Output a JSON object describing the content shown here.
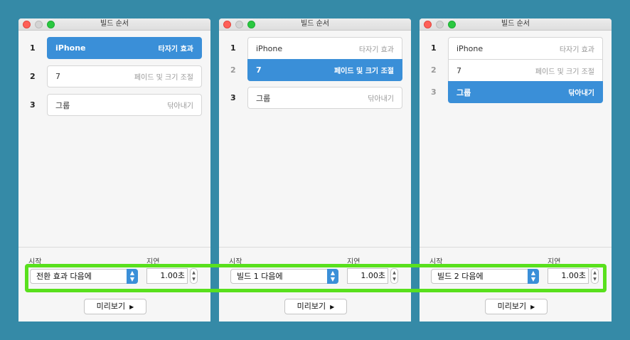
{
  "windows": [
    {
      "title": "빌드 순서",
      "builds": [
        {
          "num": "1",
          "name": "iPhone",
          "effect": "타자기 효과"
        },
        {
          "num": "2",
          "name": "7",
          "effect": "페이드 및 크기 조절"
        },
        {
          "num": "3",
          "name": "그룹",
          "effect": "닦아내기"
        }
      ],
      "selected_build": 1,
      "start_label": "시작",
      "start_value": "전환 효과 다음에",
      "delay_label": "지연",
      "delay_value": "1.00초",
      "preview_label": "미리보기"
    },
    {
      "title": "빌드 순서",
      "builds": [
        {
          "num": "1",
          "name": "iPhone",
          "effect": "타자기 효과"
        },
        {
          "num": "2",
          "name": "7",
          "effect": "페이드 및 크기 조절"
        },
        {
          "num": "3",
          "name": "그룹",
          "effect": "닦아내기"
        }
      ],
      "selected_build": 2,
      "start_label": "시작",
      "start_value": "빌드 1 다음에",
      "delay_label": "지연",
      "delay_value": "1.00초",
      "preview_label": "미리보기"
    },
    {
      "title": "빌드 순서",
      "builds": [
        {
          "num": "1",
          "name": "iPhone",
          "effect": "타자기 효과"
        },
        {
          "num": "2",
          "name": "7",
          "effect": "페이드 및 크기 조절"
        },
        {
          "num": "3",
          "name": "그룹",
          "effect": "닦아내기"
        }
      ],
      "selected_build": 3,
      "start_label": "시작",
      "start_value": "빌드 2 다음에",
      "delay_label": "지연",
      "delay_value": "1.00초",
      "preview_label": "미리보기"
    }
  ],
  "icons": {
    "select_chevron": "chevron-updown-icon",
    "stepper": "stepper-icon",
    "play": "play-icon"
  },
  "colors": {
    "background": "#358aa7",
    "selection": "#3a8fd8",
    "highlight": "#59e01d"
  }
}
